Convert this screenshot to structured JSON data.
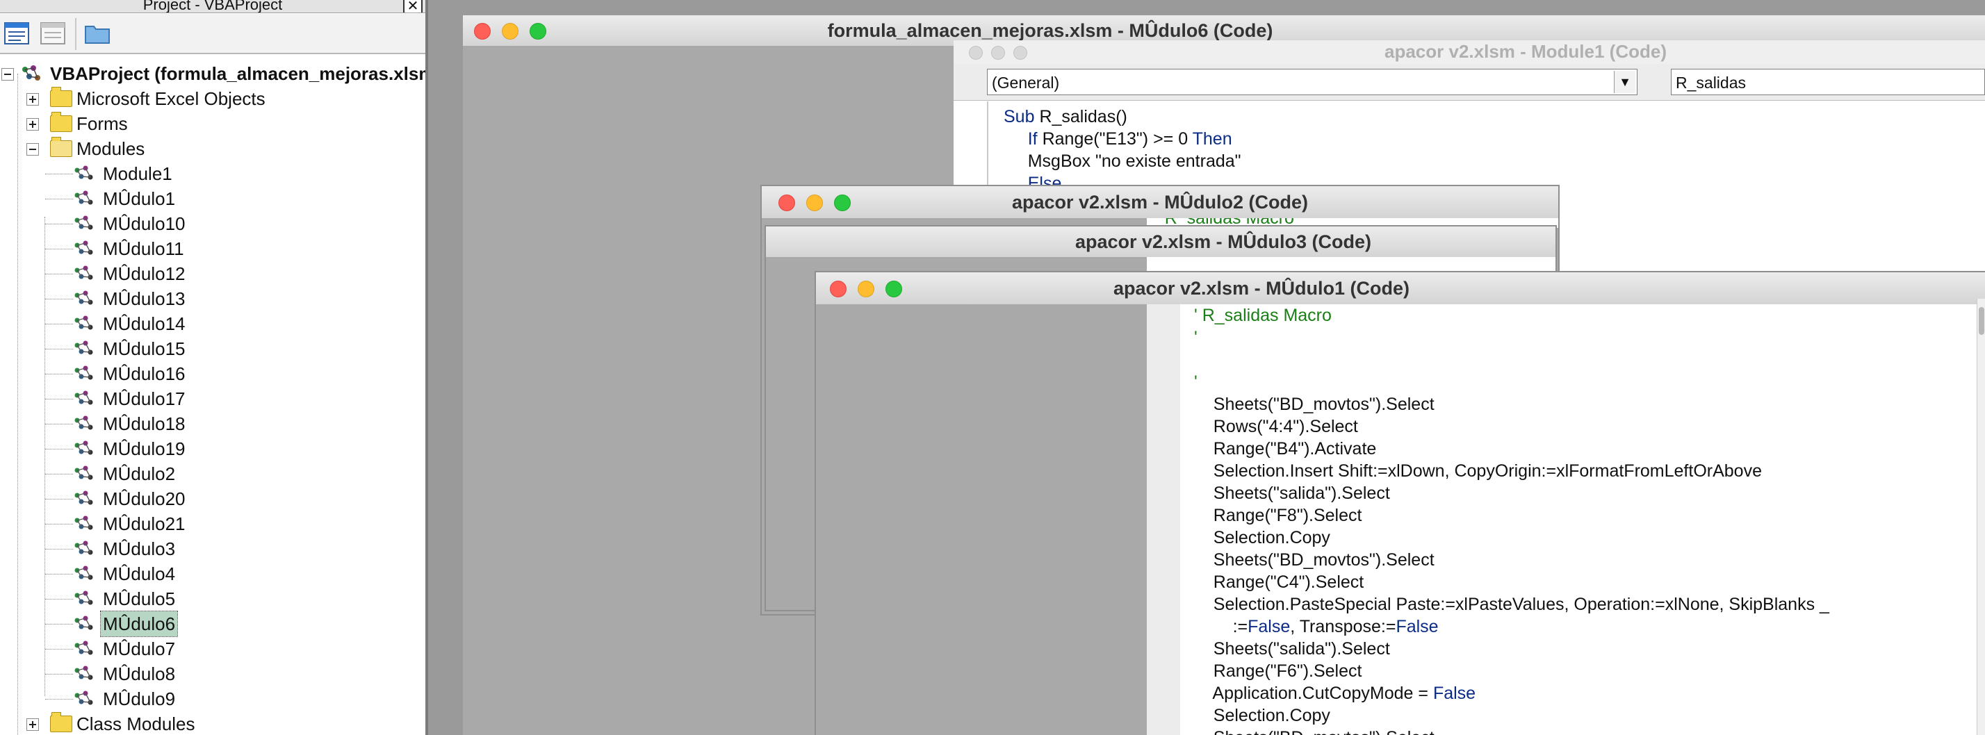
{
  "project_panel": {
    "title": "Project - VBAProject",
    "close_glyph": "✕",
    "toolbar": [
      {
        "name": "view-object-icon"
      },
      {
        "name": "view-code-icon"
      },
      {
        "name": "toggle-folders-icon"
      }
    ],
    "root_label": "VBAProject (formula_almacen_mejoras.xlsm)",
    "folders": {
      "excel_objects": "Microsoft Excel Objects",
      "forms": "Forms",
      "modules": "Modules",
      "class_modules": "Class Modules"
    },
    "modules": [
      "Module1",
      "MÛdulo1",
      "MÛdulo10",
      "MÛdulo11",
      "MÛdulo12",
      "MÛdulo13",
      "MÛdulo14",
      "MÛdulo15",
      "MÛdulo16",
      "MÛdulo17",
      "MÛdulo18",
      "MÛdulo19",
      "MÛdulo2",
      "MÛdulo20",
      "MÛdulo21",
      "MÛdulo3",
      "MÛdulo4",
      "MÛdulo5",
      "MÛdulo6",
      "MÛdulo7",
      "MÛdulo8",
      "MÛdulo9"
    ],
    "selected_module": "MÛdulo6"
  },
  "windows": {
    "main": {
      "title": "formula_almacen_mejoras.xlsm - MÛdulo6 (Code)"
    },
    "module1": {
      "title": "apacor v2.xlsm - Module1 (Code)",
      "object_dropdown": "(General)",
      "proc_dropdown": "R_salidas",
      "code": [
        [
          {
            "t": "Sub ",
            "c": "kw"
          },
          {
            "t": "R_salidas()"
          }
        ],
        [
          {
            "t": "     "
          },
          {
            "t": "If ",
            "c": "kw"
          },
          {
            "t": "Range(\"E13\") >= 0 "
          },
          {
            "t": "Then",
            "c": "kw"
          }
        ],
        [
          {
            "t": "     MsgBox \"no existe entrada\""
          }
        ],
        [
          {
            "t": "     "
          },
          {
            "t": "Else",
            "c": "kw"
          }
        ]
      ]
    },
    "modulo2": {
      "title": "apacor v2.xlsm - MÛdulo2 (Code)",
      "code_fragment": "' R_salidas Macro"
    },
    "modulo3": {
      "title": "apacor v2.xlsm - MÛdulo3 (Code)"
    },
    "modulo1": {
      "title": "apacor v2.xlsm - MÛdulo1 (Code)",
      "code": [
        [
          {
            "t": "' R_salidas Macro",
            "c": "cm"
          }
        ],
        [
          {
            "t": "'",
            "c": "cm"
          }
        ],
        [
          {
            "t": ""
          }
        ],
        [
          {
            "t": "'",
            "c": "cm"
          }
        ],
        [
          {
            "t": "    Sheets(\"BD_movtos\").Select"
          }
        ],
        [
          {
            "t": "    Rows(\"4:4\").Select"
          }
        ],
        [
          {
            "t": "    Range(\"B4\").Activate"
          }
        ],
        [
          {
            "t": "    Selection.Insert Shift:=xlDown, CopyOrigin:=xlFormatFromLeftOrAbove"
          }
        ],
        [
          {
            "t": "    Sheets(\"salida\").Select"
          }
        ],
        [
          {
            "t": "    Range(\"F8\").Select"
          }
        ],
        [
          {
            "t": "    Selection.Copy"
          }
        ],
        [
          {
            "t": "    Sheets(\"BD_movtos\").Select"
          }
        ],
        [
          {
            "t": "    Range(\"C4\").Select"
          }
        ],
        [
          {
            "t": "    Selection.PasteSpecial Paste:=xlPasteValues, Operation:=xlNone, SkipBlanks _"
          }
        ],
        [
          {
            "t": "        :="
          },
          {
            "t": "False",
            "c": "kw"
          },
          {
            "t": ", Transpose:="
          },
          {
            "t": "False",
            "c": "kw"
          }
        ],
        [
          {
            "t": "    Sheets(\"salida\").Select"
          }
        ],
        [
          {
            "t": "    Range(\"F6\").Select"
          }
        ],
        [
          {
            "t": "    Application.CutCopyMode = "
          },
          {
            "t": "False",
            "c": "kw"
          }
        ],
        [
          {
            "t": "    Selection.Copy"
          }
        ],
        [
          {
            "t": "    Sheets(\"BD_movtos\").Select"
          }
        ]
      ]
    }
  },
  "colors": {
    "keyword": "#0a2b86",
    "comment": "#1a7f16",
    "selection": "#b7d6c3",
    "window_background": "#a9a9a9",
    "desktop": "#9a9a9a"
  }
}
